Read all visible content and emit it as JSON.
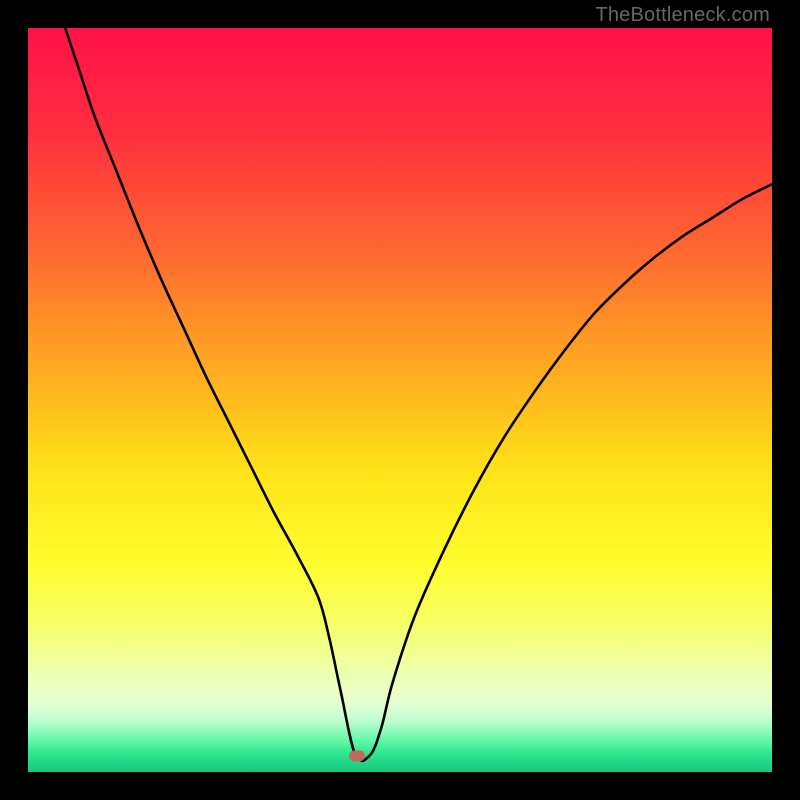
{
  "watermark": "TheBottleneck.com",
  "colors": {
    "frame": "#000000",
    "marker": "#c06a5d",
    "curve": "#000000",
    "gradient_stops": [
      {
        "offset": 0,
        "color": "#ff1246"
      },
      {
        "offset": 0.14,
        "color": "#ff2e3f"
      },
      {
        "offset": 0.3,
        "color": "#ff6830"
      },
      {
        "offset": 0.48,
        "color": "#ffb31f"
      },
      {
        "offset": 0.6,
        "color": "#ffe418"
      },
      {
        "offset": 0.72,
        "color": "#fffd2d"
      },
      {
        "offset": 0.8,
        "color": "#f7ff66"
      },
      {
        "offset": 0.86,
        "color": "#eeffa8"
      },
      {
        "offset": 0.905,
        "color": "#e7ffd1"
      },
      {
        "offset": 0.93,
        "color": "#c0ffd0"
      },
      {
        "offset": 0.958,
        "color": "#61f8a6"
      },
      {
        "offset": 0.978,
        "color": "#28e38d"
      },
      {
        "offset": 1.0,
        "color": "#17c87e"
      }
    ]
  },
  "chart_data": {
    "type": "line",
    "title": "",
    "xlabel": "",
    "ylabel": "",
    "xlim": [
      0,
      100
    ],
    "ylim": [
      0,
      100
    ],
    "grid": false,
    "legend": false,
    "marker": {
      "x": 44.2,
      "y": 2.2
    },
    "series": [
      {
        "name": "bottleneck-curve",
        "x": [
          5,
          7,
          9,
          12,
          15,
          18,
          21,
          24,
          27,
          30,
          33,
          36,
          39,
          40.5,
          42,
          44,
          46,
          47.5,
          49,
          52,
          56,
          60,
          64,
          68,
          72,
          76,
          80,
          84,
          88,
          92,
          96,
          100
        ],
        "y": [
          100,
          94,
          88,
          80.5,
          73,
          66,
          59.5,
          53,
          47,
          41,
          35,
          29.5,
          23.5,
          18,
          11,
          2.3,
          2.3,
          6,
          12,
          21,
          30,
          38,
          45,
          51,
          56.5,
          61.5,
          65.5,
          69,
          72,
          74.5,
          77,
          79
        ]
      }
    ]
  }
}
